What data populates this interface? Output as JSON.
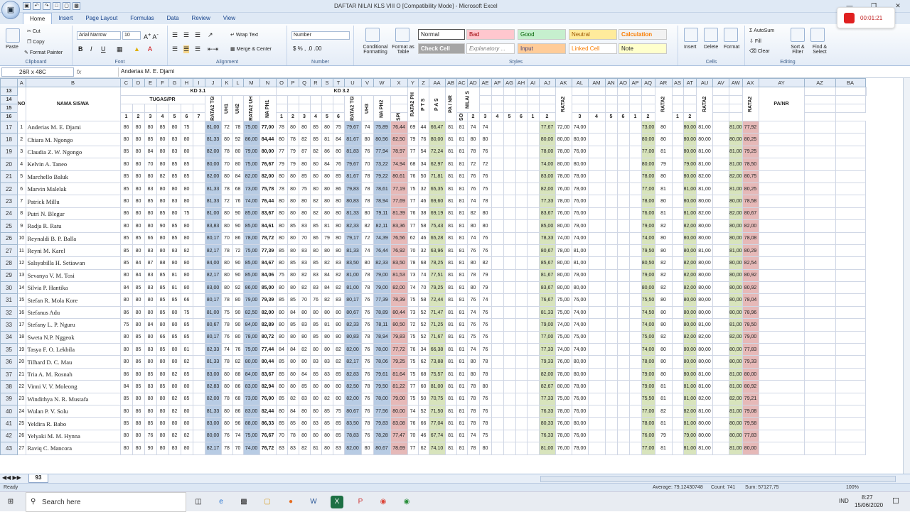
{
  "window": {
    "title": "DAFTAR NILAI KLS VIII O  [Compatibility Mode] - Microsoft Excel",
    "minimize": "—",
    "restore": "❐",
    "close": "✕"
  },
  "recorder": {
    "time": "00:01:21"
  },
  "tabs": [
    "Home",
    "Insert",
    "Page Layout",
    "Formulas",
    "Data",
    "Review",
    "View"
  ],
  "ribbon": {
    "clipboard": {
      "name": "Clipboard",
      "paste": "Paste",
      "cut": "Cut",
      "copy": "Copy",
      "format_painter": "Format Painter"
    },
    "font": {
      "name": "Font",
      "family": "Arial Narrow",
      "size": "10"
    },
    "alignment": {
      "name": "Alignment",
      "wrap": "Wrap Text",
      "merge": "Merge & Center"
    },
    "number": {
      "name": "Number",
      "format": "Number"
    },
    "styles": {
      "name": "Styles",
      "cond": "Conditional Formatting",
      "fmt_table": "Format as Table",
      "normal": "Normal",
      "bad": "Bad",
      "good": "Good",
      "neutral": "Neutral",
      "calculation": "Calculation",
      "check": "Check Cell",
      "explanatory": "Explanatory ...",
      "input": "Input",
      "linked": "Linked Cell",
      "note": "Note"
    },
    "cells": {
      "name": "Cells",
      "insert": "Insert",
      "delete": "Delete",
      "format": "Format"
    },
    "editing": {
      "name": "Editing",
      "autosum": "AutoSum",
      "fill": "Fill",
      "clear": "Clear",
      "sort": "Sort & Filter",
      "find": "Find & Select"
    }
  },
  "formula_bar": {
    "namebox": "26R x 48C",
    "fx": "fx",
    "content": "Anderias M. E. Djami"
  },
  "columns": [
    "A",
    "B",
    "C",
    "D",
    "E",
    "F",
    "G",
    "H",
    "I",
    "J",
    "K",
    "L",
    "M",
    "N",
    "O",
    "P",
    "Q",
    "R",
    "S",
    "T",
    "U",
    "V",
    "W",
    "X",
    "Y",
    "Z",
    "AA",
    "AB",
    "AC",
    "AD",
    "AE",
    "AF",
    "AG",
    "AH",
    "AI",
    "AJ",
    "AK",
    "AL",
    "AM",
    "AN",
    "AO",
    "AP",
    "AQ",
    "AR",
    "AS",
    "AT",
    "AU",
    "AV",
    "AW",
    "AX",
    "AY",
    "AZ",
    "BA"
  ],
  "headers": {
    "no": "NO",
    "nama": "NAMA SISWA",
    "kd31": "KD 3.1",
    "kd32": "KD 3.2",
    "tugas": "TUGAS/PR",
    "rata2tgs": "RATA2 TGS",
    "uh1": "UH1",
    "uh2": "UH2",
    "rata2uh": "RATA2 UH",
    "naph1": "NA PH1",
    "uh3": "UH3",
    "naph2": "NA PH2",
    "rata2ph": "RATA2 PH",
    "pts": "P T S",
    "pas": "P A S",
    "panr": "PA / NR",
    "nilais": "NILAI S",
    "spirit": "SPIRT",
    "sosial": "SOSIAL",
    "rata2": "RATA2",
    "panr2": "PA/NR",
    "n1": "1",
    "n2": "2",
    "n3": "3",
    "n4": "4",
    "n5": "5",
    "n6": "6",
    "n7": "7"
  },
  "row_numbers": [
    "13",
    "14",
    "15",
    "16"
  ],
  "students": [
    [
      "17",
      "1",
      "Anderias M. E. Djami",
      "86",
      "80",
      "80",
      "85",
      "80",
      "75",
      "81,00",
      "72",
      "78",
      "75,00",
      "77,00",
      "78",
      "80",
      "80",
      "85",
      "80",
      "75",
      "79,67",
      "74",
      "75,89",
      "76,44",
      "69",
      "44",
      "66,47",
      "81",
      "81",
      "74",
      "74",
      "77,67",
      "72,00",
      "74,00",
      "73,00",
      "80",
      "80,00",
      "81,00",
      "81,00",
      "77,92"
    ],
    [
      "18",
      "2",
      "Chiara M. Ngongo",
      "80",
      "80",
      "85",
      "80",
      "83",
      "80",
      "81,33",
      "80",
      "92",
      "86,00",
      "84,44",
      "80",
      "78",
      "82",
      "85",
      "81",
      "84",
      "81,67",
      "80",
      "80,56",
      "82,50",
      "79",
      "76",
      "80,00",
      "81",
      "81",
      "80",
      "80",
      "80,00",
      "80,00",
      "80,00",
      "80,00",
      "80",
      "80,00",
      "80,00",
      "80,00",
      "80,25"
    ],
    [
      "19",
      "3",
      "Claudia Z. W. Ngongo",
      "85",
      "80",
      "84",
      "80",
      "83",
      "80",
      "82,00",
      "78",
      "80",
      "79,00",
      "80,00",
      "77",
      "79",
      "87",
      "82",
      "86",
      "80",
      "81,83",
      "76",
      "77,94",
      "78,97",
      "77",
      "54",
      "72,24",
      "81",
      "81",
      "78",
      "76",
      "78,00",
      "78,00",
      "76,00",
      "77,00",
      "81",
      "80,00",
      "81,00",
      "81,00",
      "79,25"
    ],
    [
      "20",
      "4",
      "Kelvin A. Taneo",
      "80",
      "80",
      "70",
      "80",
      "85",
      "85",
      "80,00",
      "70",
      "80",
      "75,00",
      "76,67",
      "79",
      "79",
      "80",
      "80",
      "84",
      "76",
      "79,67",
      "70",
      "73,22",
      "74,94",
      "68",
      "34",
      "62,97",
      "81",
      "81",
      "72",
      "72",
      "74,00",
      "80,00",
      "80,00",
      "80,00",
      "79",
      "79,00",
      "81,00",
      "81,00",
      "78,50"
    ],
    [
      "21",
      "5",
      "Marchello Baluk",
      "85",
      "80",
      "80",
      "82",
      "85",
      "85",
      "82,00",
      "80",
      "84",
      "82,00",
      "82,00",
      "80",
      "80",
      "85",
      "80",
      "80",
      "85",
      "81,67",
      "78",
      "79,22",
      "80,61",
      "76",
      "50",
      "71,81",
      "81",
      "81",
      "76",
      "76",
      "83,00",
      "78,00",
      "78,00",
      "78,00",
      "80",
      "80,00",
      "82,00",
      "82,00",
      "80,75"
    ],
    [
      "22",
      "6",
      "Marvin Malelak",
      "85",
      "80",
      "83",
      "80",
      "80",
      "80",
      "81,33",
      "78",
      "68",
      "73,00",
      "75,78",
      "78",
      "80",
      "75",
      "80",
      "80",
      "86",
      "79,83",
      "78",
      "78,61",
      "77,19",
      "75",
      "32",
      "65,35",
      "81",
      "81",
      "76",
      "75",
      "82,00",
      "76,00",
      "78,00",
      "77,00",
      "81",
      "81,00",
      "81,00",
      "81,00",
      "80,25"
    ],
    [
      "23",
      "7",
      "Patrick Millu",
      "80",
      "80",
      "85",
      "80",
      "83",
      "80",
      "81,33",
      "72",
      "76",
      "74,00",
      "76,44",
      "80",
      "80",
      "80",
      "82",
      "80",
      "80",
      "80,83",
      "78",
      "78,94",
      "77,69",
      "77",
      "46",
      "69,60",
      "81",
      "81",
      "74",
      "78",
      "77,33",
      "78,00",
      "76,00",
      "78,00",
      "80",
      "80,00",
      "80,00",
      "80,00",
      "78,58"
    ],
    [
      "24",
      "8",
      "Putri N. Blegur",
      "86",
      "80",
      "80",
      "85",
      "80",
      "75",
      "81,00",
      "80",
      "90",
      "85,00",
      "83,67",
      "80",
      "80",
      "80",
      "82",
      "80",
      "80",
      "81,33",
      "80",
      "79,11",
      "81,39",
      "76",
      "38",
      "69,19",
      "81",
      "81",
      "82",
      "80",
      "83,67",
      "76,00",
      "76,00",
      "76,00",
      "81",
      "81,00",
      "82,00",
      "82,00",
      "80,67"
    ],
    [
      "25",
      "9",
      "Radja R. Ratu",
      "80",
      "80",
      "80",
      "90",
      "85",
      "80",
      "83,83",
      "80",
      "90",
      "85,00",
      "84,61",
      "80",
      "85",
      "83",
      "85",
      "81",
      "80",
      "82,33",
      "82",
      "82,11",
      "83,36",
      "77",
      "58",
      "75,43",
      "81",
      "81",
      "80",
      "80",
      "85,00",
      "80,00",
      "78,00",
      "79,00",
      "82",
      "82,00",
      "80,00",
      "80,00",
      "82,00"
    ],
    [
      "26",
      "10",
      "Reynaldi B. P. Balla",
      "85",
      "85",
      "66",
      "80",
      "85",
      "80",
      "80,17",
      "70",
      "86",
      "78,00",
      "78,72",
      "80",
      "80",
      "70",
      "86",
      "79",
      "80",
      "79,17",
      "72",
      "74,39",
      "76,56",
      "62",
      "46",
      "65,28",
      "81",
      "81",
      "74",
      "76",
      "78,33",
      "74,00",
      "74,00",
      "74,00",
      "80",
      "80,00",
      "80,00",
      "80,00",
      "78,08"
    ],
    [
      "27",
      "11",
      "Reyni M. Karel",
      "85",
      "80",
      "83",
      "80",
      "83",
      "82",
      "82,17",
      "78",
      "72",
      "75,00",
      "77,39",
      "85",
      "80",
      "83",
      "80",
      "80",
      "80",
      "81,33",
      "74",
      "76,44",
      "76,92",
      "70",
      "32",
      "63,96",
      "81",
      "81",
      "76",
      "76",
      "80,67",
      "78,00",
      "81,00",
      "79,50",
      "80",
      "80,00",
      "81,00",
      "81,00",
      "80,29"
    ],
    [
      "28",
      "12",
      "Salsyabilla H. Setiawan",
      "85",
      "84",
      "87",
      "88",
      "80",
      "80",
      "84,00",
      "80",
      "90",
      "85,00",
      "84,67",
      "80",
      "85",
      "83",
      "85",
      "82",
      "83",
      "83,50",
      "80",
      "82,33",
      "83,50",
      "78",
      "68",
      "78,25",
      "81",
      "81",
      "80",
      "82",
      "85,67",
      "80,00",
      "81,00",
      "80,50",
      "82",
      "82,00",
      "80,00",
      "80,00",
      "82,54"
    ],
    [
      "29",
      "13",
      "Sevanya V. M. Tosi",
      "80",
      "84",
      "83",
      "85",
      "81",
      "80",
      "82,17",
      "80",
      "90",
      "85,00",
      "84,06",
      "75",
      "80",
      "82",
      "83",
      "84",
      "82",
      "81,00",
      "78",
      "79,00",
      "81,53",
      "73",
      "74",
      "77,51",
      "81",
      "81",
      "78",
      "79",
      "81,67",
      "80,00",
      "78,00",
      "79,00",
      "82",
      "82,00",
      "80,00",
      "80,00",
      "80,92"
    ],
    [
      "30",
      "14",
      "Silvia P. Hantika",
      "84",
      "85",
      "83",
      "85",
      "81",
      "80",
      "83,00",
      "80",
      "92",
      "86,00",
      "85,00",
      "80",
      "80",
      "82",
      "83",
      "84",
      "82",
      "81,00",
      "78",
      "79,00",
      "82,00",
      "74",
      "70",
      "79,25",
      "81",
      "81",
      "80",
      "79",
      "83,67",
      "80,00",
      "80,00",
      "80,00",
      "82",
      "82,00",
      "80,00",
      "80,00",
      "80,92"
    ],
    [
      "31",
      "15",
      "Stefan R. Mola Kore",
      "80",
      "80",
      "80",
      "85",
      "85",
      "66",
      "80,17",
      "78",
      "80",
      "79,00",
      "79,39",
      "85",
      "85",
      "70",
      "76",
      "82",
      "83",
      "80,17",
      "76",
      "77,39",
      "78,39",
      "75",
      "58",
      "72,44",
      "81",
      "81",
      "76",
      "74",
      "76,67",
      "75,00",
      "76,00",
      "75,50",
      "80",
      "80,00",
      "80,00",
      "80,00",
      "78,04"
    ],
    [
      "32",
      "16",
      "Stefanus Adu",
      "86",
      "80",
      "80",
      "85",
      "80",
      "75",
      "81,00",
      "75",
      "90",
      "82,50",
      "82,00",
      "80",
      "84",
      "80",
      "80",
      "80",
      "80",
      "80,67",
      "76",
      "78,89",
      "80,44",
      "73",
      "52",
      "71,47",
      "81",
      "81",
      "74",
      "76",
      "81,33",
      "75,00",
      "74,00",
      "74,50",
      "80",
      "80,00",
      "80,00",
      "80,00",
      "78,96"
    ],
    [
      "33",
      "17",
      "Stefany L. P. Nguru",
      "75",
      "80",
      "84",
      "80",
      "80",
      "85",
      "80,67",
      "78",
      "90",
      "84,00",
      "82,89",
      "80",
      "85",
      "83",
      "85",
      "81",
      "80",
      "82,33",
      "76",
      "78,11",
      "80,50",
      "72",
      "52",
      "71,25",
      "81",
      "81",
      "76",
      "76",
      "79,00",
      "74,00",
      "74,00",
      "74,00",
      "80",
      "80,00",
      "81,00",
      "81,00",
      "78,50"
    ],
    [
      "34",
      "18",
      "Sweta N.P. Nggeok",
      "80",
      "85",
      "80",
      "66",
      "85",
      "85",
      "80,17",
      "76",
      "80",
      "78,00",
      "80,72",
      "80",
      "80",
      "80",
      "85",
      "80",
      "80",
      "80,83",
      "78",
      "78,94",
      "79,83",
      "75",
      "52",
      "71,67",
      "81",
      "81",
      "75",
      "76",
      "77,00",
      "75,00",
      "75,00",
      "75,00",
      "82",
      "82,00",
      "82,00",
      "82,00",
      "79,00"
    ],
    [
      "35",
      "19",
      "Tasya F. O. Lekbila",
      "80",
      "85",
      "83",
      "85",
      "80",
      "81",
      "82,33",
      "74",
      "76",
      "75,00",
      "77,44",
      "84",
      "84",
      "82",
      "80",
      "80",
      "82",
      "82,00",
      "76",
      "78,00",
      "77,72",
      "76",
      "34",
      "66,38",
      "81",
      "81",
      "74",
      "76",
      "77,33",
      "74,00",
      "74,00",
      "74,00",
      "80",
      "80,00",
      "80,00",
      "80,00",
      "77,83"
    ],
    [
      "36",
      "20",
      "Tilhard D. C. Mau",
      "80",
      "86",
      "80",
      "80",
      "80",
      "82",
      "81,33",
      "78",
      "82",
      "80,00",
      "80,44",
      "85",
      "80",
      "80",
      "83",
      "83",
      "82",
      "82,17",
      "76",
      "78,06",
      "79,25",
      "75",
      "62",
      "73,88",
      "81",
      "81",
      "80",
      "78",
      "79,33",
      "76,00",
      "80,00",
      "78,00",
      "80",
      "80,00",
      "80,00",
      "80,00",
      "79,33"
    ],
    [
      "37",
      "21",
      "Tria A. M. Rosnah",
      "86",
      "80",
      "85",
      "80",
      "82",
      "85",
      "83,00",
      "80",
      "88",
      "84,00",
      "83,67",
      "85",
      "80",
      "84",
      "85",
      "83",
      "85",
      "82,83",
      "76",
      "79,61",
      "81,64",
      "75",
      "68",
      "75,57",
      "81",
      "81",
      "80",
      "78",
      "82,00",
      "78,00",
      "80,00",
      "79,00",
      "80",
      "80,00",
      "81,00",
      "81,00",
      "80,00"
    ],
    [
      "38",
      "22",
      "Vinni V. V. Moleong",
      "84",
      "85",
      "83",
      "85",
      "80",
      "80",
      "82,83",
      "80",
      "86",
      "83,00",
      "82,94",
      "80",
      "80",
      "85",
      "80",
      "80",
      "80",
      "82,50",
      "78",
      "79,50",
      "81,22",
      "77",
      "60",
      "81,00",
      "81",
      "81",
      "78",
      "80",
      "82,67",
      "80,00",
      "78,00",
      "79,00",
      "81",
      "81,00",
      "81,00",
      "81,00",
      "80,92"
    ],
    [
      "39",
      "23",
      "Windithya N. R. Mustafa",
      "85",
      "80",
      "80",
      "80",
      "82",
      "85",
      "82,00",
      "78",
      "68",
      "73,00",
      "76,00",
      "85",
      "82",
      "83",
      "80",
      "82",
      "80",
      "82,00",
      "76",
      "78,00",
      "79,00",
      "75",
      "50",
      "70,75",
      "81",
      "81",
      "78",
      "76",
      "77,33",
      "75,00",
      "76,00",
      "75,50",
      "81",
      "81,00",
      "82,00",
      "82,00",
      "79,21"
    ],
    [
      "40",
      "24",
      "Wulan P. V. Solu",
      "80",
      "86",
      "80",
      "80",
      "82",
      "80",
      "81,33",
      "80",
      "86",
      "83,00",
      "82,44",
      "80",
      "84",
      "80",
      "80",
      "85",
      "75",
      "80,67",
      "76",
      "77,56",
      "80,00",
      "74",
      "52",
      "71,50",
      "81",
      "81",
      "78",
      "76",
      "76,33",
      "78,00",
      "76,00",
      "77,00",
      "82",
      "82,00",
      "81,00",
      "81,00",
      "79,08"
    ],
    [
      "41",
      "25",
      "Yeldira R. Babo",
      "85",
      "88",
      "85",
      "80",
      "80",
      "80",
      "83,00",
      "80",
      "96",
      "88,00",
      "86,33",
      "85",
      "85",
      "80",
      "83",
      "85",
      "85",
      "83,50",
      "78",
      "79,83",
      "83,08",
      "76",
      "66",
      "77,04",
      "81",
      "81",
      "78",
      "78",
      "80,33",
      "76,00",
      "80,00",
      "78,00",
      "81",
      "81,00",
      "80,00",
      "80,00",
      "79,58"
    ],
    [
      "42",
      "26",
      "Yelyaki M. M. Hynna",
      "80",
      "80",
      "76",
      "80",
      "82",
      "82",
      "80,00",
      "76",
      "74",
      "75,00",
      "76,67",
      "70",
      "78",
      "80",
      "80",
      "80",
      "85",
      "78,83",
      "76",
      "78,28",
      "77,47",
      "70",
      "46",
      "67,74",
      "81",
      "81",
      "74",
      "75",
      "76,33",
      "78,00",
      "76,00",
      "76,00",
      "79",
      "79,00",
      "80,00",
      "80,00",
      "77,83"
    ],
    [
      "43",
      "27",
      "Raviq C. Mancora",
      "80",
      "80",
      "90",
      "80",
      "83",
      "80",
      "82,17",
      "78",
      "70",
      "74,00",
      "76,72",
      "83",
      "83",
      "82",
      "81",
      "80",
      "83",
      "82,00",
      "80",
      "80,67",
      "78,69",
      "77",
      "62",
      "74,10",
      "81",
      "81",
      "78",
      "80",
      "81,00",
      "76,00",
      "78,00",
      "77,00",
      "81",
      "81,00",
      "81,00",
      "81,00",
      "80,00"
    ]
  ],
  "sheet_tab": "93",
  "status": {
    "ready": "Ready",
    "average": "Average: 79,12430748",
    "count": "Count: 741",
    "sum": "Sum: 57127,75",
    "zoom": "100%"
  },
  "taskbar": {
    "search": "Search here",
    "lang": "IND",
    "time": "8:27",
    "date": "15/06/2020"
  }
}
